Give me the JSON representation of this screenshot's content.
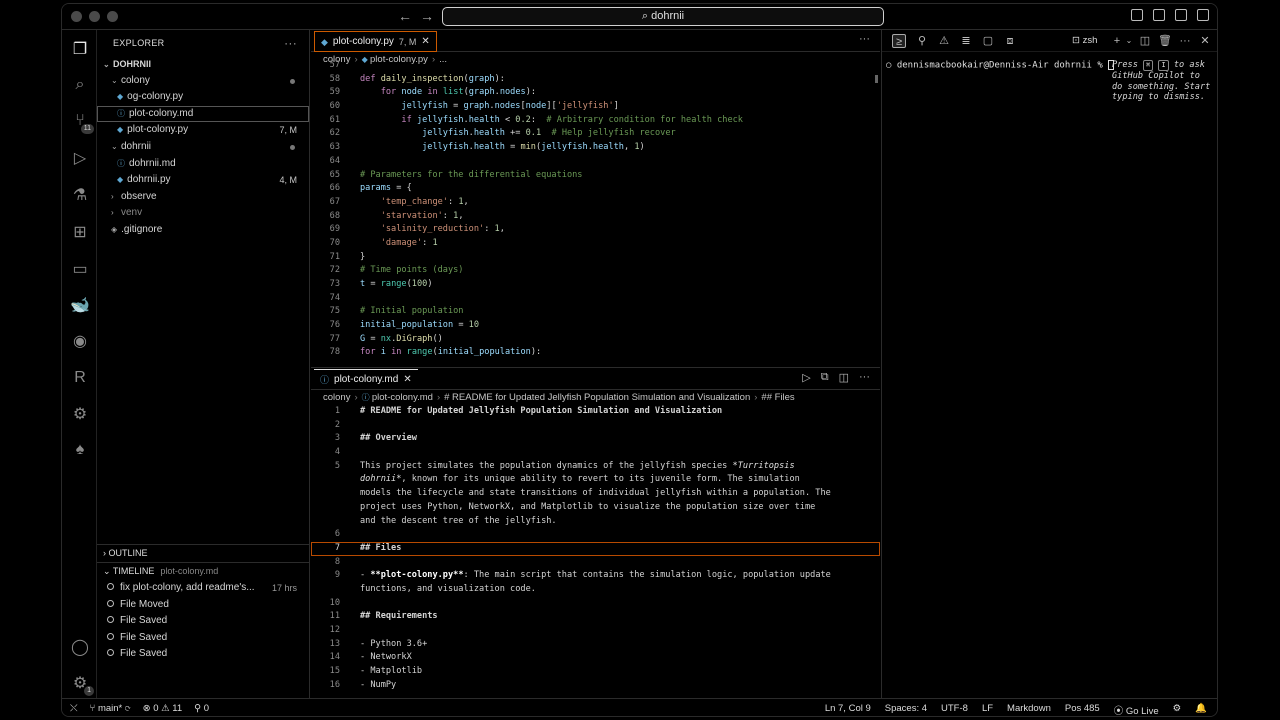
{
  "titlebar": {
    "command_center": "dohrnii",
    "back": "←",
    "forward": "→"
  },
  "activity": [
    "explorer-icon",
    "search-icon",
    "source-control-icon",
    "run-debug-icon",
    "testing-icon",
    "extensions-icon",
    "remote-explorer-icon",
    "docker-icon",
    "github-icon",
    "r-icon",
    "copilot-icon",
    "mongodb-icon",
    "account-icon",
    "settings-icon"
  ],
  "activity_badges": {
    "source_control": "11",
    "settings": "1"
  },
  "explorer": {
    "title": "EXPLORER",
    "more": "···",
    "root": "DOHRNII",
    "items": [
      {
        "label": "colony",
        "type": "folder",
        "stat": ""
      },
      {
        "label": "og-colony.py",
        "type": "py",
        "stat": ""
      },
      {
        "label": "plot-colony.md",
        "type": "md",
        "stat": ""
      },
      {
        "label": "plot-colony.py",
        "type": "py",
        "stat": "7, M"
      },
      {
        "label": "dohrnii",
        "type": "folder",
        "stat": ""
      },
      {
        "label": "dohrnii.md",
        "type": "md",
        "stat": ""
      },
      {
        "label": "dohrnii.py",
        "type": "py",
        "stat": "4, M"
      },
      {
        "label": "observe",
        "type": "folder-closed",
        "stat": ""
      },
      {
        "label": "venv",
        "type": "folder-closed",
        "stat": ""
      },
      {
        "label": ".gitignore",
        "type": "git",
        "stat": ""
      }
    ]
  },
  "outline": {
    "title": "OUTLINE"
  },
  "timeline": {
    "title": "TIMELINE",
    "file": "plot-colony.md",
    "entries": [
      {
        "label": "fix plot-colony, add readme's...",
        "time": "17 hrs"
      },
      {
        "label": "File Moved",
        "time": ""
      },
      {
        "label": "File Saved",
        "time": ""
      },
      {
        "label": "File Saved",
        "time": ""
      },
      {
        "label": "File Saved",
        "time": ""
      }
    ]
  },
  "editor_top": {
    "tab": {
      "label": "plot-colony.py",
      "stat": "7, M",
      "close": "✕"
    },
    "more": "···",
    "breadcrumb": [
      "colony",
      "plot-colony.py",
      "..."
    ],
    "line_numbers": [
      "57",
      "58",
      "59",
      "60",
      "61",
      "62",
      "63",
      "64",
      "65",
      "66",
      "67",
      "68",
      "69",
      "70",
      "71",
      "72",
      "73",
      "74",
      "75",
      "76",
      "77",
      "78"
    ]
  },
  "editor_bottom": {
    "tab": {
      "label": "plot-colony.md",
      "close": "✕"
    },
    "more": "···",
    "breadcrumb": [
      "colony",
      "plot-colony.md",
      "# README for Updated Jellyfish Population Simulation and Visualization",
      "## Files"
    ],
    "line_numbers": [
      "1",
      "2",
      "3",
      "4",
      "5",
      "",
      "",
      "",
      "",
      "6",
      "7",
      "8",
      "9",
      "",
      "10",
      "11",
      "12",
      "13",
      "14",
      "15",
      "16"
    ]
  },
  "terminal": {
    "shell": "zsh",
    "prompt": "dennismacbookair@Denniss-Air dohrnii %",
    "hint_press": "Press",
    "hint_key1": "⌘",
    "hint_key2": "I",
    "hint_rest": "to ask GitHub Copilot to do something. Start typing to dismiss."
  },
  "status": {
    "branch": "main*",
    "sync": "⟳",
    "errors": "0",
    "warnings": "11",
    "ports": "0",
    "position": "Ln 7, Col 9",
    "spaces": "Spaces: 4",
    "encoding": "UTF-8",
    "eol": "LF",
    "language": "Markdown",
    "pos": "Pos 485",
    "golive": "Go Live"
  }
}
